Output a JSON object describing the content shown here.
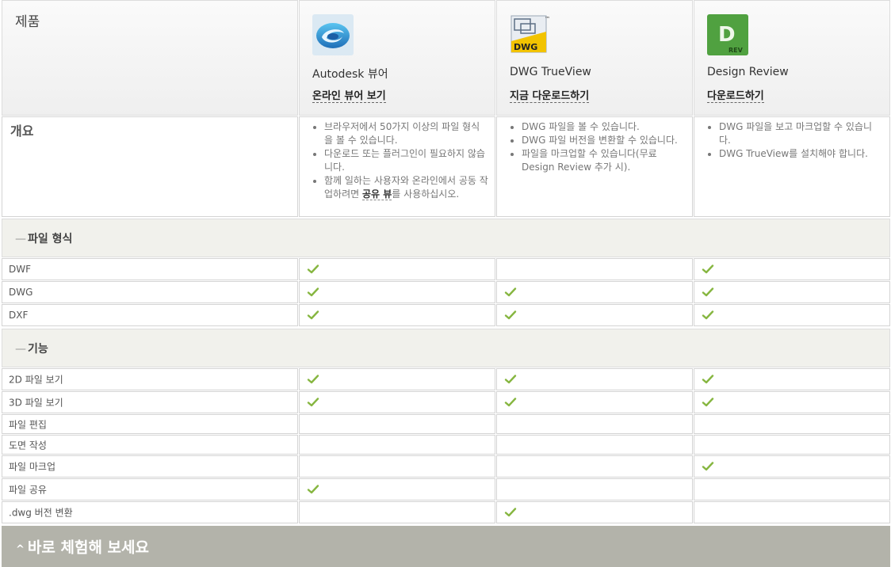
{
  "header": {
    "title": "제품",
    "products": [
      {
        "name": "Autodesk 뷰어",
        "link": "온라인 뷰어 보기",
        "icon": "autodesk-viewer-logo"
      },
      {
        "name": "DWG TrueView",
        "link": "지금 다운로드하기",
        "icon": "dwg-trueview-logo",
        "logo_text": "DWG",
        "trademark": "™"
      },
      {
        "name": "Design Review",
        "link": "다운로드하기",
        "icon": "design-review-logo",
        "logo_letter": "D",
        "logo_text": "REV"
      }
    ]
  },
  "overview": {
    "label": "개요",
    "col1": {
      "item1": "브라우저에서 50가지 이상의 파일 형식을 볼 수 있습니다.",
      "item2": "다운로드 또는 플러그인이 필요하지 않습니다.",
      "item3_pre": "함께 일하는 사용자와 온라인에서 공동 작업하려면 ",
      "item3_link": "공유 뷰",
      "item3_post": "를 사용하십시오."
    },
    "col2": [
      "DWG 파일을 볼 수 있습니다.",
      "DWG 파일 버전을 변환할 수 있습니다.",
      "파일을 마크업할 수 있습니다(무료 Design Review 추가 시)."
    ],
    "col3": [
      "DWG 파일을 보고 마크업할 수 있습니다.",
      "DWG TrueView를 설치해야 합니다."
    ]
  },
  "sections": {
    "formats": {
      "dash": "—",
      "label": "파일 형식",
      "rows": [
        {
          "label": "DWF",
          "checks": [
            true,
            false,
            true
          ]
        },
        {
          "label": "DWG",
          "checks": [
            true,
            true,
            true
          ]
        },
        {
          "label": "DXF",
          "checks": [
            true,
            true,
            true
          ]
        }
      ]
    },
    "features": {
      "dash": "—",
      "label": "기능",
      "rows": [
        {
          "label": "2D 파일 보기",
          "checks": [
            true,
            true,
            true
          ]
        },
        {
          "label": "3D 파일 보기",
          "checks": [
            true,
            true,
            true
          ]
        },
        {
          "label": "파일 편집",
          "checks": [
            false,
            false,
            false
          ]
        },
        {
          "label": "도면 작성",
          "checks": [
            false,
            false,
            false
          ]
        },
        {
          "label": "파일 마크업",
          "checks": [
            false,
            false,
            true
          ]
        },
        {
          "label": "파일 공유",
          "checks": [
            true,
            false,
            false
          ]
        },
        {
          "label": ".dwg 버전 변환",
          "checks": [
            false,
            true,
            false
          ]
        }
      ]
    }
  },
  "cta": {
    "label": "바로 체험해 보세요",
    "caret": "^"
  },
  "colors": {
    "check": "#86b640",
    "section_bg": "#f1f1ec",
    "cta_bg": "#b3b3aa",
    "border": "#d4d4d4"
  }
}
